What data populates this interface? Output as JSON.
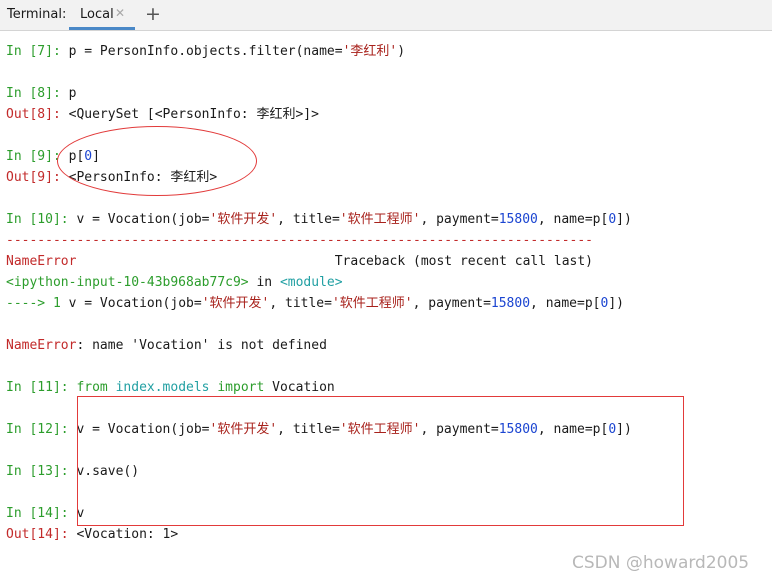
{
  "tabbar": {
    "label": "Terminal:",
    "tab_label": "Local",
    "close_glyph": "✕",
    "add_glyph": "+"
  },
  "colors": {
    "prompt": "#2c9d2c",
    "output": "#c22a2a",
    "string": "#a8221c",
    "number": "#1b45d1",
    "module": "#22a0a3",
    "annotation": "#e23a3a"
  },
  "lines": [
    [
      {
        "t": "In [7]: ",
        "c": "g"
      },
      {
        "t": "p = PersonInfo.objects.filter(name="
      },
      {
        "t": "'李红利'",
        "c": "s"
      },
      {
        "t": ")"
      }
    ],
    [],
    [
      {
        "t": "In [8]: ",
        "c": "g"
      },
      {
        "t": "p"
      }
    ],
    [
      {
        "t": "Out[8]: ",
        "c": "r"
      },
      {
        "t": "<QuerySet [<PersonInfo: 李红利>]>"
      }
    ],
    [],
    [
      {
        "t": "In [9]: ",
        "c": "g"
      },
      {
        "t": "p["
      },
      {
        "t": "0",
        "c": "n"
      },
      {
        "t": "]"
      }
    ],
    [
      {
        "t": "Out[9]: ",
        "c": "r"
      },
      {
        "t": "<PersonInfo: 李红利>"
      }
    ],
    [],
    [
      {
        "t": "In [10]: ",
        "c": "g"
      },
      {
        "t": "v = Vocation(job="
      },
      {
        "t": "'软件开发'",
        "c": "s"
      },
      {
        "t": ", title="
      },
      {
        "t": "'软件工程师'",
        "c": "s"
      },
      {
        "t": ", payment="
      },
      {
        "t": "15800",
        "c": "n"
      },
      {
        "t": ", name=p["
      },
      {
        "t": "0",
        "c": "n"
      },
      {
        "t": "])"
      }
    ],
    [
      {
        "t": "---------------------------------------------------------------------------",
        "c": "r"
      }
    ],
    [
      {
        "t": "NameError",
        "c": "r"
      },
      {
        "t": "                                 Traceback (most recent call last)"
      }
    ],
    [
      {
        "t": "<ipython-input-10-43b968ab77c9>",
        "c": "g"
      },
      {
        "t": " in "
      },
      {
        "t": "<module>",
        "c": "c"
      }
    ],
    [
      {
        "t": "----> 1 ",
        "c": "g"
      },
      {
        "t": "v = Vocation(job="
      },
      {
        "t": "'软件开发'",
        "c": "s"
      },
      {
        "t": ", title="
      },
      {
        "t": "'软件工程师'",
        "c": "s"
      },
      {
        "t": ", payment="
      },
      {
        "t": "15800",
        "c": "n"
      },
      {
        "t": ", name=p["
      },
      {
        "t": "0",
        "c": "n"
      },
      {
        "t": "])"
      }
    ],
    [],
    [
      {
        "t": "NameError",
        "c": "r"
      },
      {
        "t": ": name 'Vocation' is not defined"
      }
    ],
    [],
    [
      {
        "t": "In [11]: ",
        "c": "g"
      },
      {
        "t": "from ",
        "c": "g"
      },
      {
        "t": "index.models ",
        "c": "c"
      },
      {
        "t": "import ",
        "c": "g"
      },
      {
        "t": "Vocation"
      }
    ],
    [],
    [
      {
        "t": "In [12]: ",
        "c": "g"
      },
      {
        "t": "v = Vocation(job="
      },
      {
        "t": "'软件开发'",
        "c": "s"
      },
      {
        "t": ", title="
      },
      {
        "t": "'软件工程师'",
        "c": "s"
      },
      {
        "t": ", payment="
      },
      {
        "t": "15800",
        "c": "n"
      },
      {
        "t": ", name=p["
      },
      {
        "t": "0",
        "c": "n"
      },
      {
        "t": "])"
      }
    ],
    [],
    [
      {
        "t": "In [13]: ",
        "c": "g"
      },
      {
        "t": "v.save()"
      }
    ],
    [],
    [
      {
        "t": "In [14]: ",
        "c": "g"
      },
      {
        "t": "v"
      }
    ],
    [
      {
        "t": "Out[14]: ",
        "c": "r"
      },
      {
        "t": "<Vocation: 1>"
      }
    ]
  ],
  "watermark": "CSDN @howard2005"
}
